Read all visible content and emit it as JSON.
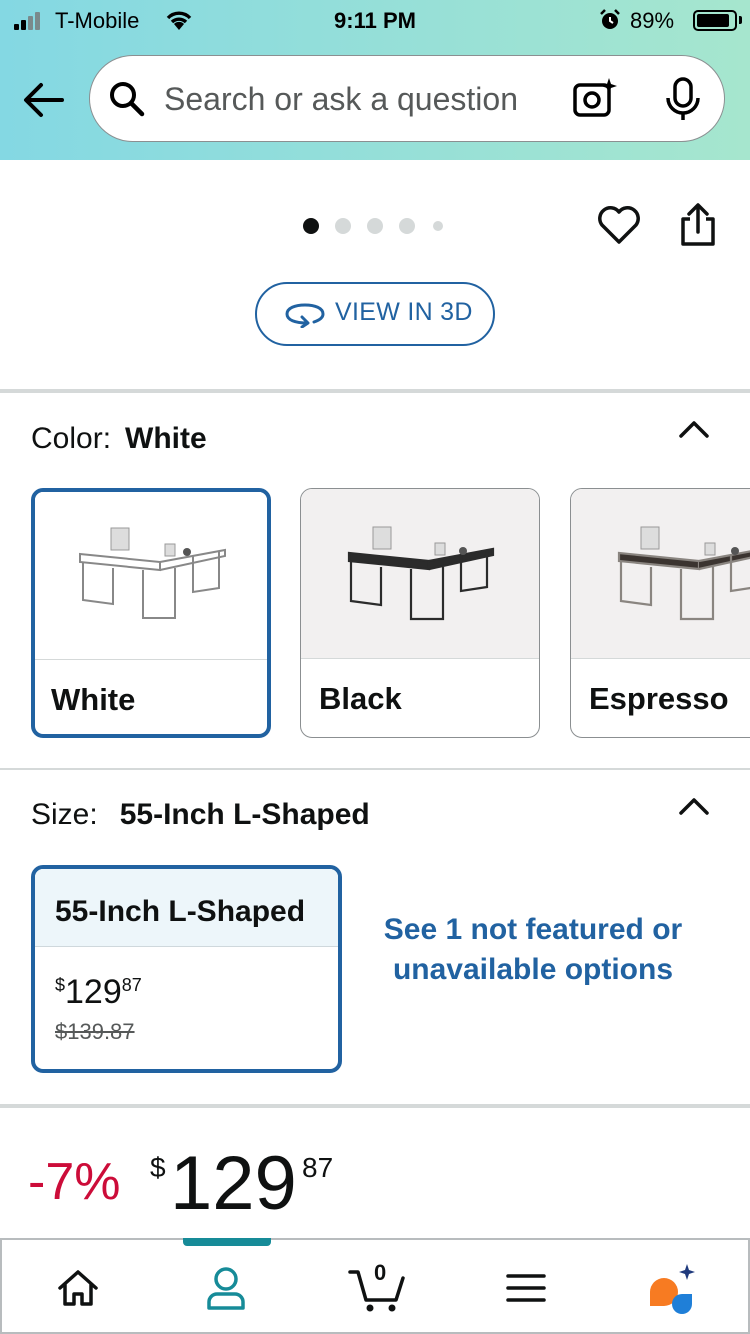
{
  "status_bar": {
    "carrier": "T-Mobile",
    "time": "9:11 PM",
    "battery_percent": "89%",
    "battery_level": 0.89,
    "signal_bars": 2
  },
  "search": {
    "placeholder": "Search or ask a question"
  },
  "gallery": {
    "image_count": 5,
    "active_index": 0,
    "view_3d_label": "VIEW IN 3D"
  },
  "color": {
    "label": "Color:",
    "selected": "White",
    "options": [
      {
        "label": "White",
        "desk_color": "#ffffff",
        "selected": true
      },
      {
        "label": "Black",
        "desk_color": "#2b2b2b",
        "selected": false
      },
      {
        "label": "Espresso",
        "desk_color": "#3b3430",
        "selected": false
      }
    ]
  },
  "size": {
    "label": "Size:",
    "selected": "55-Inch L-Shaped",
    "option": {
      "label": "55-Inch L-Shaped",
      "price_currency": "$",
      "price_whole": "129",
      "price_fraction": "87",
      "list_price": "$139.87"
    },
    "see_more": "See 1 not featured or unavailable options"
  },
  "price": {
    "discount": "-7%",
    "currency": "$",
    "whole": "129",
    "fraction": "87"
  },
  "bottom_nav": {
    "items": [
      {
        "name": "home-icon"
      },
      {
        "name": "account-icon",
        "active": true
      },
      {
        "name": "cart-icon"
      },
      {
        "name": "menu-icon"
      },
      {
        "name": "rufus-icon"
      }
    ],
    "cart_count": "0"
  },
  "colors": {
    "accent_blue": "#2162a1",
    "discount_red": "#cc0c39",
    "active_teal": "#168b98",
    "header_gradient_start": "#84d8e3",
    "header_gradient_end": "#a6e6ce"
  }
}
